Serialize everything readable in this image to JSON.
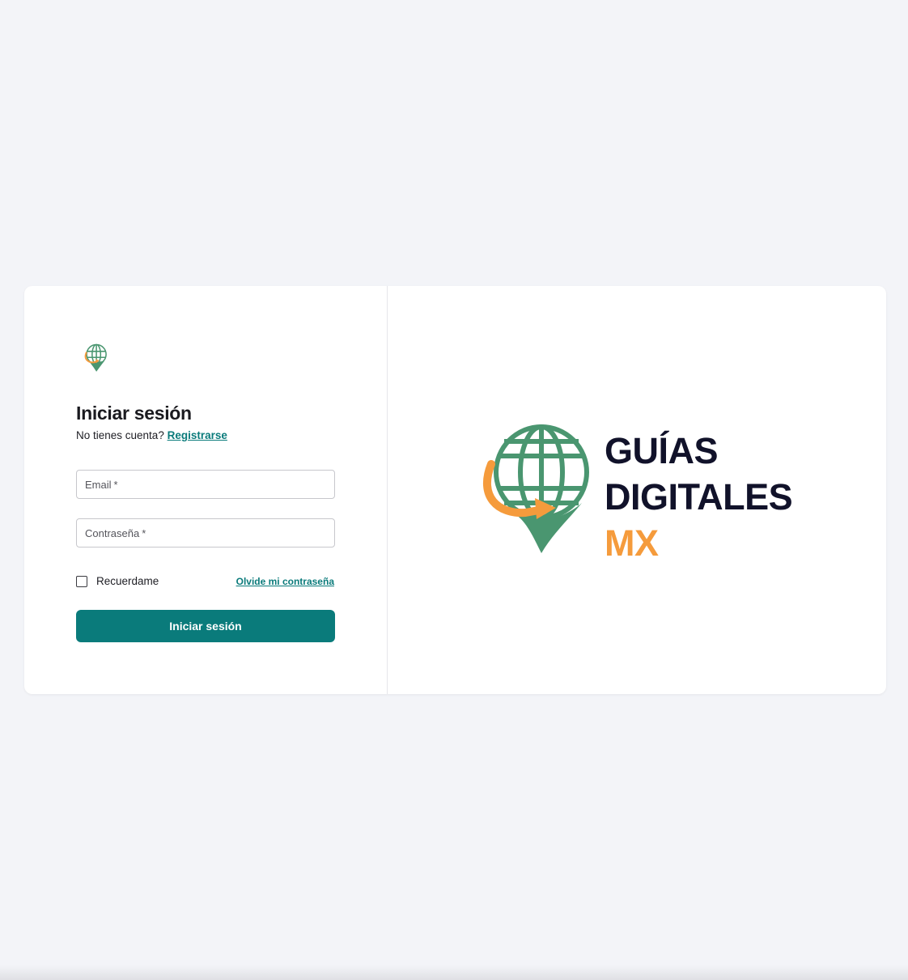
{
  "login": {
    "title": "Iniciar sesión",
    "no_account_text": "No tienes cuenta?",
    "register_link": "Registrarse",
    "email_label": "Email",
    "password_label": "Contraseña",
    "required_mark": "*",
    "remember_label": "Recuerdame",
    "forgot_link": "Olvide mi contraseña",
    "submit_label": "Iniciar sesión"
  },
  "brand": {
    "line1": "GUÍAS",
    "line2": "DIGITALES",
    "line3": "MX",
    "colors": {
      "teal": "#0a7b7b",
      "globe_green": "#4a9670",
      "orange": "#f59b3c",
      "navy": "#11122a"
    }
  }
}
